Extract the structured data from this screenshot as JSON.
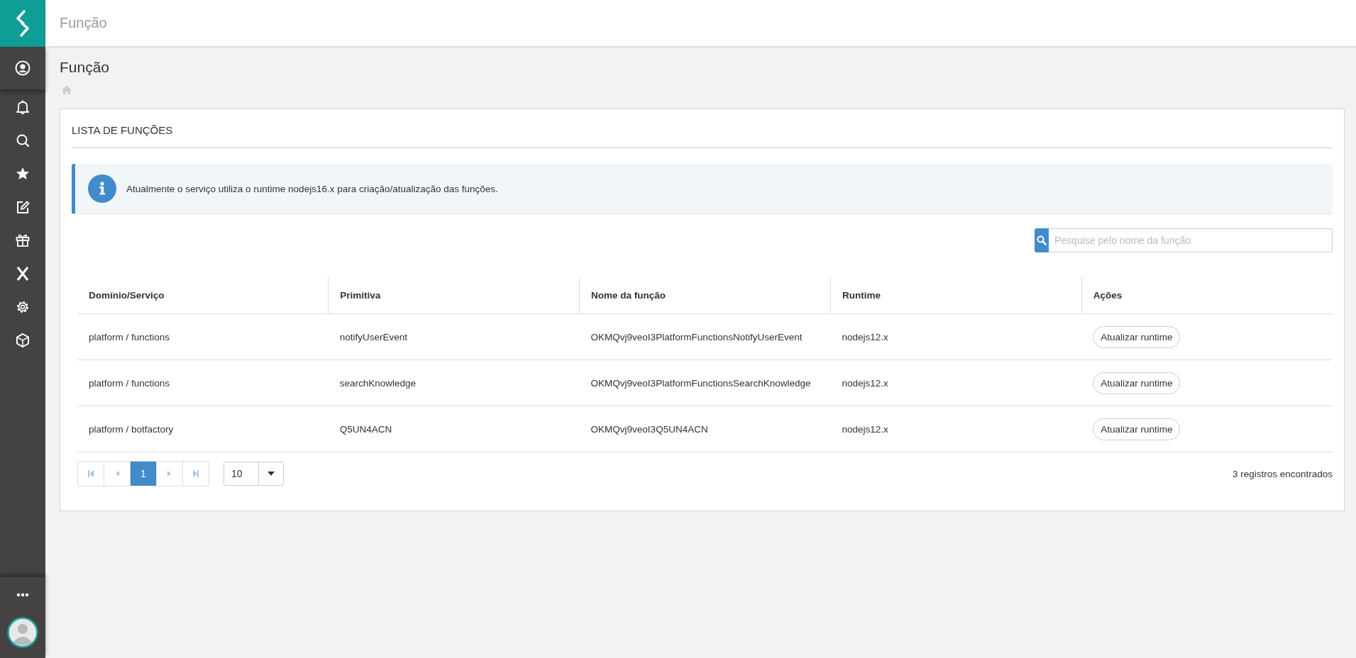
{
  "header": {
    "title": "Função"
  },
  "page": {
    "title": "Função"
  },
  "card": {
    "title": "LISTA DE FUNÇÕES",
    "info": "Atualmente o serviço utiliza o runtime nodejs16.x para criação/atualização das funções.",
    "search": {
      "placeholder": "Pesquise pelo nome da função"
    },
    "table": {
      "columns": [
        "Domínio/Serviço",
        "Primitiva",
        "Nome da função",
        "Runtime",
        "Ações"
      ],
      "rows": [
        {
          "domain": "platform / functions",
          "primitive": "notifyUserEvent",
          "name": "OKMQvj9veoI3PlatformFunctionsNotifyUserEvent",
          "runtime": "nodejs12.x",
          "action": "Atualizar runtime"
        },
        {
          "domain": "platform / functions",
          "primitive": "searchKnowledge",
          "name": "OKMQvj9veoI3PlatformFunctionsSearchKnowledge",
          "runtime": "nodejs12.x",
          "action": "Atualizar runtime"
        },
        {
          "domain": "platform / botfactory",
          "primitive": "Q5UN4ACN",
          "name": "OKMQvj9veoI3Q5UN4ACN",
          "runtime": "nodejs12.x",
          "action": "Atualizar runtime"
        }
      ]
    },
    "pagination": {
      "pages": [
        {
          "label": "1",
          "selected": true
        }
      ],
      "page_size": "10"
    },
    "count": "3 registros encontrados"
  }
}
